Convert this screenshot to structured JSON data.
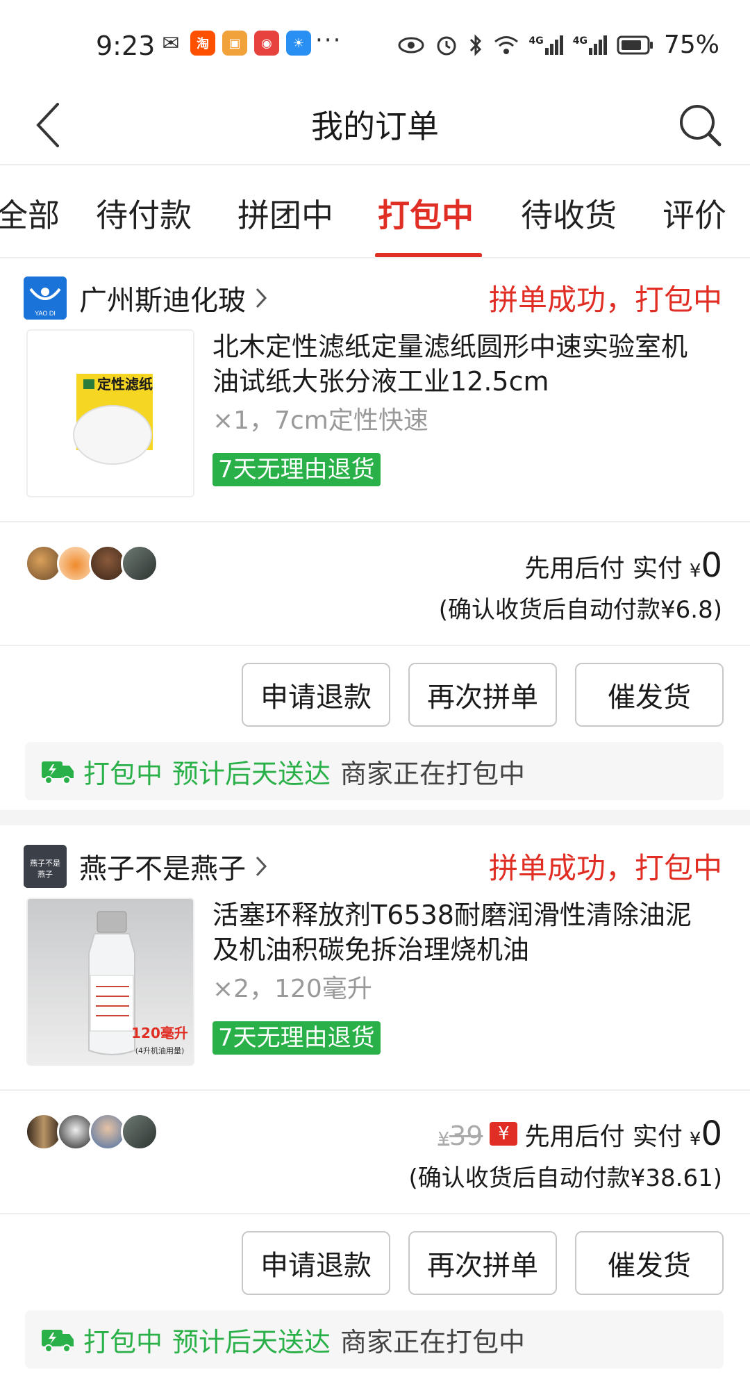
{
  "status_bar": {
    "time": "9:23",
    "signal_label_1": "4G",
    "signal_label_2": "4G",
    "battery": "75%"
  },
  "header": {
    "title": "我的订单"
  },
  "tabs": [
    {
      "label": "全部"
    },
    {
      "label": "待付款"
    },
    {
      "label": "拼团中"
    },
    {
      "label": "打包中"
    },
    {
      "label": "待收货"
    },
    {
      "label": "评价"
    }
  ],
  "active_tab": "打包中",
  "colors": {
    "accent": "#e02e24",
    "green": "#2ab048"
  },
  "orders": [
    {
      "shop_logo_text": "YAO DI",
      "shop_name": "广州斯迪化玻",
      "status": "拼单成功，打包中",
      "product_title": "北木定性滤纸定量滤纸圆形中速实验室机油试纸大张分液工业12.5cm",
      "thumb_text": "定性滤纸",
      "spec": "×1，7cm定性快速",
      "return_badge": "7天无理由退货",
      "original_price": "",
      "pay_label": "先用后付  实付",
      "currency": "¥",
      "paid": "0",
      "autopay_note": "(确认收货后自动付款¥6.8)",
      "buttons": [
        "申请退款",
        "再次拼单",
        "催发货"
      ],
      "ship_status": "打包中",
      "ship_eta": "预计后天送达",
      "ship_note": "商家正在打包中"
    },
    {
      "shop_logo_text": "燕子不是燕子",
      "shop_name": "燕子不是燕子",
      "status": "拼单成功，打包中",
      "product_title": "活塞环释放剂T6538耐磨润滑性清除油泥及机油积碳免拆治理烧机油",
      "thumb_text": "120毫升",
      "thumb_subtext": "(4升机油用量)",
      "spec": "×2，120毫升",
      "return_badge": "7天无理由退货",
      "original_price": "39",
      "red_tag": "¥",
      "pay_label": "先用后付  实付",
      "currency": "¥",
      "paid": "0",
      "autopay_note": "(确认收货后自动付款¥38.61)",
      "buttons": [
        "申请退款",
        "再次拼单",
        "催发货"
      ],
      "ship_status": "打包中",
      "ship_eta": "预计后天送达",
      "ship_note": "商家正在打包中"
    }
  ]
}
